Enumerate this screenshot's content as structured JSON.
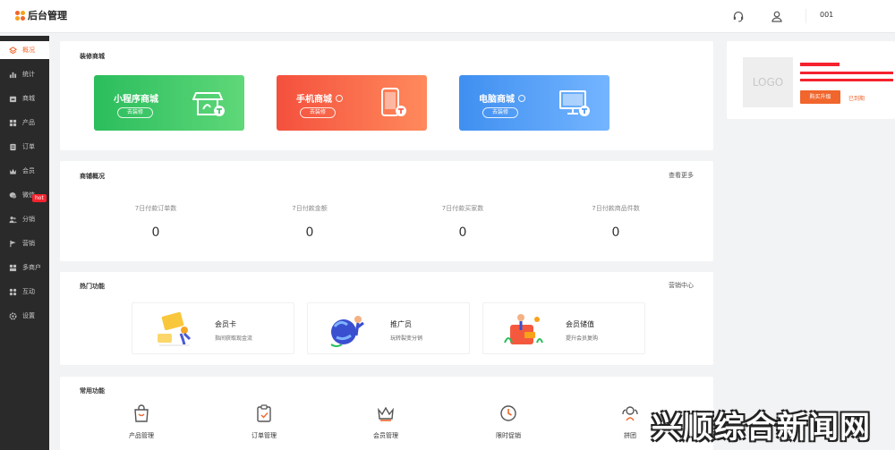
{
  "header": {
    "title": "后台管理",
    "username": "001",
    "brand_colors": [
      "#f0662c",
      "#f7a21b",
      "#f0662c",
      "#f7a21b"
    ]
  },
  "sidebar": {
    "items": [
      {
        "label": "概况",
        "icon": "layers-icon",
        "active": true
      },
      {
        "label": "统计",
        "icon": "chart-icon"
      },
      {
        "label": "商城",
        "icon": "store-icon"
      },
      {
        "label": "产品",
        "icon": "grid-icon"
      },
      {
        "label": "订单",
        "icon": "order-icon"
      },
      {
        "label": "会员",
        "icon": "crown-icon"
      },
      {
        "label": "微信",
        "icon": "wechat-icon"
      },
      {
        "label": "分销",
        "icon": "people-icon"
      },
      {
        "label": "营销",
        "icon": "flag-icon"
      },
      {
        "label": "多商户",
        "icon": "merchant-icon"
      },
      {
        "label": "互动",
        "icon": "apps-icon"
      },
      {
        "label": "设置",
        "icon": "gear-icon"
      }
    ],
    "hot_badge": "hot"
  },
  "decorate": {
    "title": "装修商城",
    "shops": [
      {
        "name": "小程序商城",
        "button": "去装修",
        "color": "#2dbe60"
      },
      {
        "name": "手机商城",
        "button": "去装修",
        "color": "#f4593e"
      },
      {
        "name": "电脑商城",
        "button": "去装修",
        "color": "#4a96f0"
      }
    ]
  },
  "overview": {
    "title": "商铺概况",
    "more": "查看更多",
    "stats": [
      {
        "label": "7日付款订单数",
        "value": "0"
      },
      {
        "label": "7日付款金额",
        "value": "0"
      },
      {
        "label": "7日付款买家数",
        "value": "0"
      },
      {
        "label": "7日付款商品件数",
        "value": "0"
      }
    ]
  },
  "hot": {
    "title": "热门功能",
    "link": "营销中心",
    "features": [
      {
        "name": "会员卡",
        "desc": "指间获取现金流"
      },
      {
        "name": "推广员",
        "desc": "玩转裂变分销"
      },
      {
        "name": "会员储值",
        "desc": "提升会员复购"
      }
    ]
  },
  "common": {
    "title": "常用功能",
    "tools": [
      {
        "label": "产品管理",
        "icon": "bag-icon"
      },
      {
        "label": "订单管理",
        "icon": "clipboard-icon"
      },
      {
        "label": "会员管理",
        "icon": "crown-icon"
      },
      {
        "label": "限时促销",
        "icon": "clock-icon"
      },
      {
        "label": "拼团",
        "icon": "group-icon"
      }
    ]
  },
  "account": {
    "logo_text": "LOGO",
    "buy_button": "购买升级",
    "expired": "已到期"
  },
  "watermark": {
    "text": "兴顺综合新闻网"
  }
}
